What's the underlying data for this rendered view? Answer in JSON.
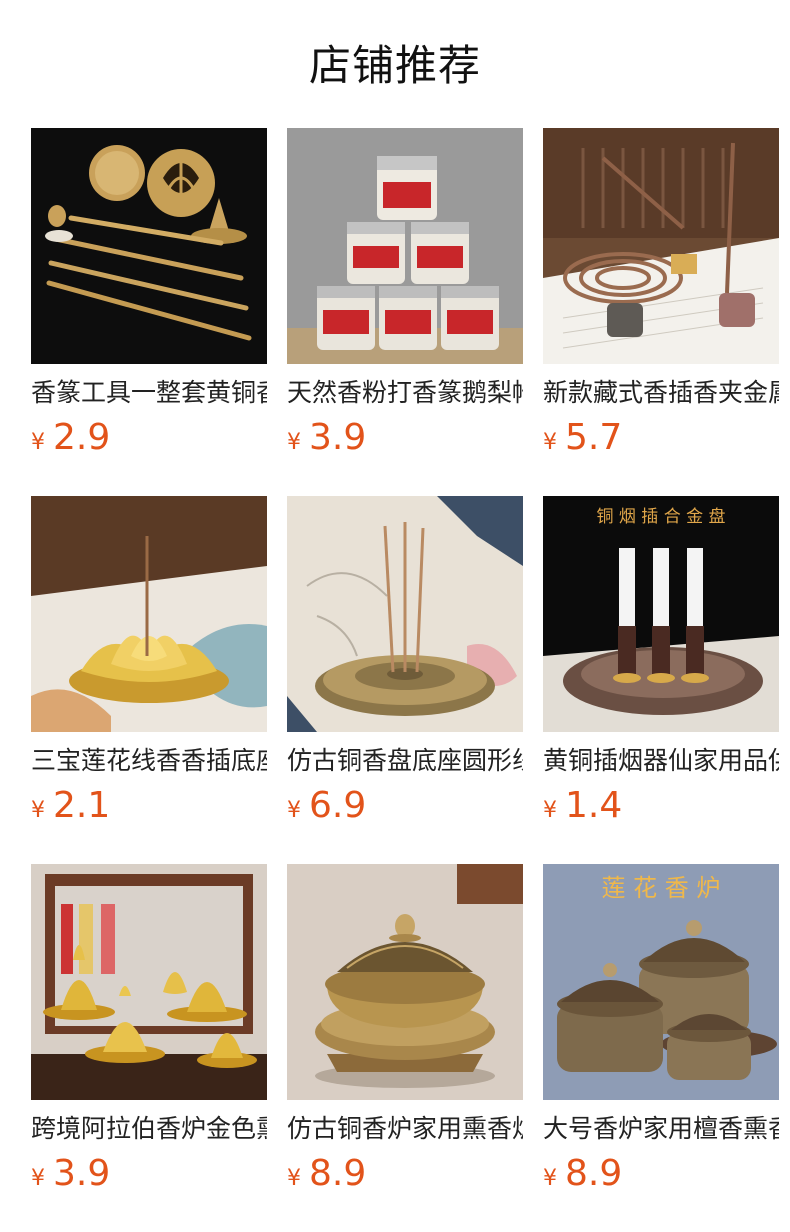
{
  "section_title": "店铺推荐",
  "currency_symbol": "¥",
  "products": [
    {
      "name": "香篆工具一整套黄铜香篆模具",
      "price": "2.9",
      "image_text": ""
    },
    {
      "name": "天然香粉打香篆鹅梨帐中香",
      "price": "3.9",
      "image_text": ""
    },
    {
      "name": "新款藏式香插香夹金属盘香",
      "price": "5.7",
      "image_text": ""
    },
    {
      "name": "三宝莲花线香香插底座家用",
      "price": "2.1",
      "image_text": ""
    },
    {
      "name": "仿古铜香盘底座圆形线香插",
      "price": "6.9",
      "image_text": ""
    },
    {
      "name": "黄铜插烟器仙家用品供烟",
      "price": "1.4",
      "image_text": "铜 烟 插 合 金 盘"
    },
    {
      "name": "跨境阿拉伯香炉金色熏香炉",
      "price": "3.9",
      "image_text": ""
    },
    {
      "name": "仿古铜香炉家用熏香炉室内",
      "price": "8.9",
      "image_text": ""
    },
    {
      "name": "大号香炉家用檀香熏香炉",
      "price": "8.9",
      "image_text": "莲 花 香 炉"
    }
  ]
}
